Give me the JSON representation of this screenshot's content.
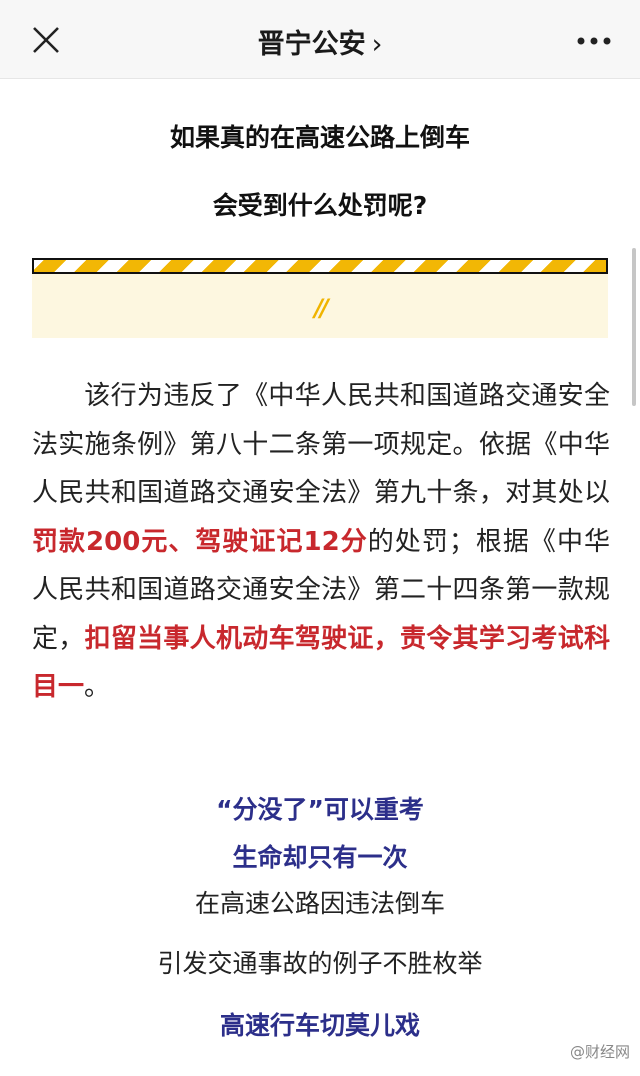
{
  "topbar": {
    "title": "晋宁公安",
    "chevron": "›",
    "close_icon": "close-icon",
    "more_icon": "more-icon"
  },
  "headings": {
    "line1": "如果真的在高速公路上倒车",
    "line2": "会受到什么处罚呢?"
  },
  "decoration": {
    "mark": "//",
    "stripe_colors": [
      "#f2b705",
      "#ffffff"
    ]
  },
  "body": {
    "part1": "该行为违反了《中华人民共和国道路交通安全法实施条例》第八十二条第一项规定。依据《中华人民共和国道路交通安全法》第九十条，对其处以",
    "red1": "罚款200元、驾驶证记12分",
    "part2": "的处罚；根据《中华人民共和国道路交通安全法》第二十四条第一款规定，",
    "red2": "扣留当事人机动车驾驶证，责令其学习考试科目一",
    "part3": "。"
  },
  "closing": {
    "line1": "“分没了”可以重考",
    "line2": "生命却只有一次",
    "line3": "在高速公路因违法倒车",
    "line4": "引发交通事故的例子不胜枚举",
    "line5": "高速行车切莫儿戏"
  },
  "watermark": "@财经网",
  "colors": {
    "accent_red": "#c8282d",
    "accent_blue": "#2c2f8a",
    "stripe_yellow": "#f2b705"
  }
}
